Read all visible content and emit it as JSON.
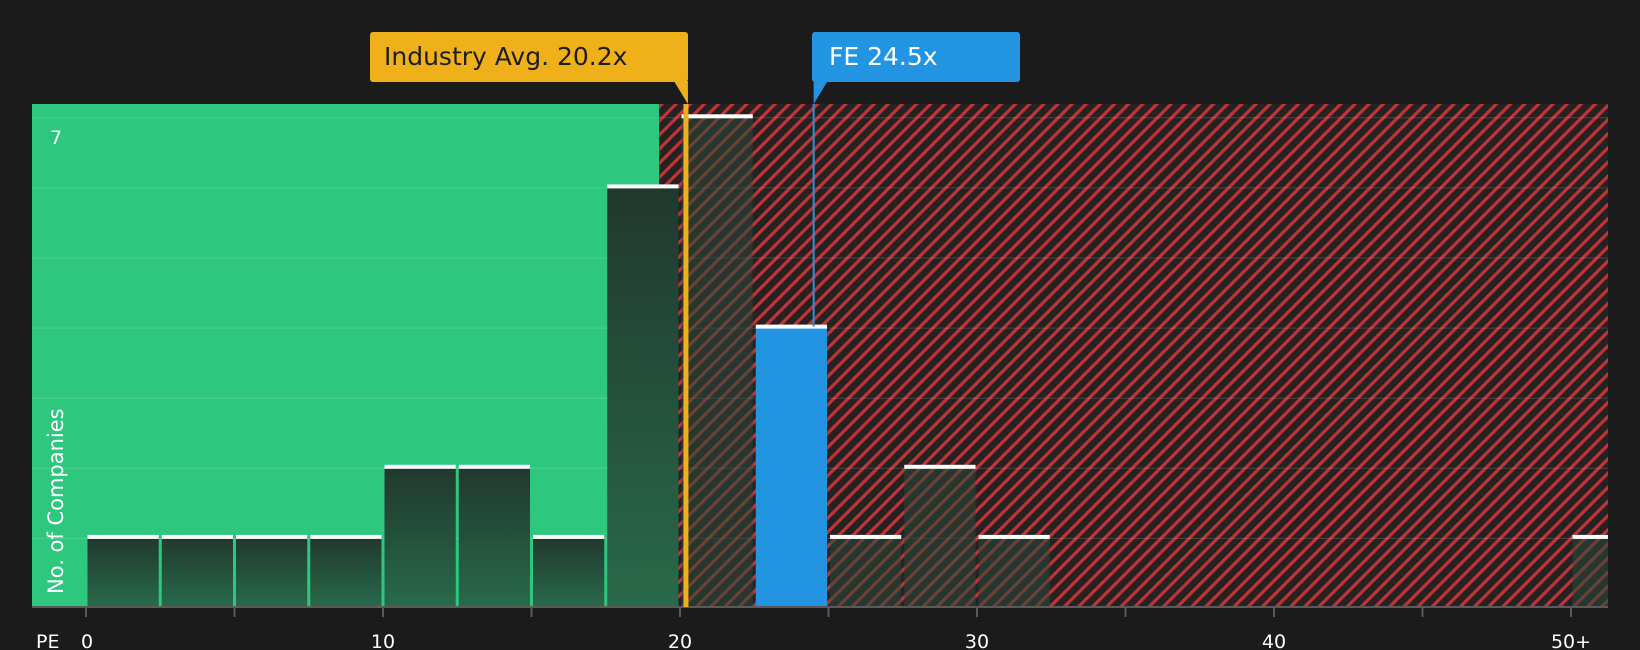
{
  "chart_data": {
    "type": "bar",
    "xlabel": "PE",
    "ylabel": "No. of Companies",
    "x_ticks": [
      "0",
      "10",
      "20",
      "30",
      "40",
      "50+"
    ],
    "y_ticks": [
      "7"
    ],
    "xlim": [
      0,
      51.5
    ],
    "ylim": [
      0,
      7.25
    ],
    "bins": [
      {
        "start": 0,
        "end": 2.5,
        "count": 1
      },
      {
        "start": 2.5,
        "end": 5,
        "count": 1
      },
      {
        "start": 5,
        "end": 7.5,
        "count": 1
      },
      {
        "start": 7.5,
        "end": 10,
        "count": 1
      },
      {
        "start": 10,
        "end": 12.5,
        "count": 2
      },
      {
        "start": 12.5,
        "end": 15,
        "count": 2
      },
      {
        "start": 15,
        "end": 17.5,
        "count": 1
      },
      {
        "start": 17.5,
        "end": 20,
        "count": 6
      },
      {
        "start": 20,
        "end": 22.5,
        "count": 7
      },
      {
        "start": 22.5,
        "end": 25,
        "count": 4,
        "highlight": true
      },
      {
        "start": 25,
        "end": 27.5,
        "count": 1
      },
      {
        "start": 27.5,
        "end": 30,
        "count": 2
      },
      {
        "start": 30,
        "end": 32.5,
        "count": 1
      },
      {
        "start": 50,
        "end": 52.5,
        "count": 1
      }
    ],
    "industry_avg": {
      "label": "Industry Avg. 20.2x",
      "value": 20.2
    },
    "company": {
      "label": "FE 24.5x",
      "value": 24.5
    },
    "fair_zone_end": 19.3,
    "colors": {
      "background": "#1b1b1b",
      "fair_zone": "#2dc77e",
      "overvalued_hatch": "#c03434",
      "industry": "#f0b01a",
      "company": "#2394e1",
      "bar": "#274a3a",
      "bar_cap": "#ffffff"
    }
  }
}
